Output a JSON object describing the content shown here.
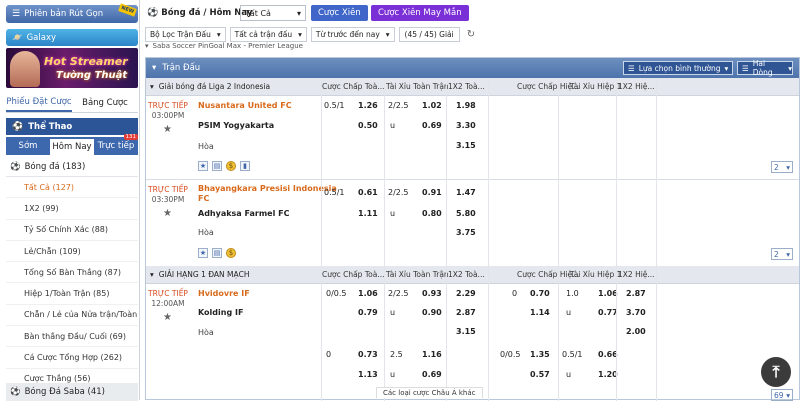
{
  "sidebar": {
    "rut_gon": "Phiên bản Rút Gọn",
    "new_tag": "NEW",
    "galaxy": "Galaxy",
    "banner_line1": "Hot Streamer",
    "banner_line2": "Tường Thuật",
    "tab_phieu": "Phiếu Đặt Cược",
    "tab_bang": "Bảng Cược",
    "sport_title": "Thể Thao",
    "tab_som": "Sớm",
    "tab_homnay": "Hôm Nay",
    "tab_tructiep": "Trực tiếp",
    "tructiep_badge": "131",
    "bongda": "Bóng đá  (183)",
    "items": [
      "Tất Cả  (127)",
      "1X2  (99)",
      "Tỷ Số Chính Xác  (88)",
      "Lẻ/Chẵn  (109)",
      "Tổng Số Bàn Thắng  (87)",
      "Hiệp 1/Toàn Trận  (85)",
      "Chẵn / Lẻ của Nửa trận/Toàn  (78)",
      "Bàn thắng Đầu/ Cuối  (69)",
      "Cá Cược Tổng Hợp  (262)",
      "Cược Thắng  (56)"
    ],
    "saba": "Bóng Đá Saba  (41)"
  },
  "topbar": {
    "title": "Bóng đá / Hôm Nay",
    "select": "Tất Cả",
    "btn_xien": "Cược Xiên",
    "btn_may": "Cược Xiên May Mắn"
  },
  "filters": {
    "f1": "Bộ Lọc Trận Đấu",
    "f2": "Tất cả trận đấu",
    "f3": "Từ trước đến nay",
    "count": "(45 / 45) Giải"
  },
  "league_top": "Saba Soccer PinGoal Max - Premier League",
  "panel": {
    "title": "Trận Đấu",
    "dd1": "Lựa chọn bình thường",
    "dd2": "Hai Dòng"
  },
  "headers": {
    "c1": "Cược Chấp Toà...",
    "c2": "Tài Xỉu Toàn Trận",
    "c3": "1X2 Toà...",
    "c4": "Cược Chấp Hiệ...",
    "c5": "Tài Xỉu Hiệp 1",
    "c6": "1X2 Hiệ..."
  },
  "leagues": {
    "l1": "Giải bóng đá Liga 2 Indonesia",
    "l2": "GIẢI HẠNG 1 ĐAN MẠCH"
  },
  "matches": {
    "m1": {
      "live": "TRỰC TIẾP",
      "time": "03:00PM",
      "home": "Nusantara United FC",
      "away": "PSIM Yogyakarta",
      "draw": "Hòa",
      "h1": "0.5/1",
      "h1o": "1.26",
      "t1": "2/2.5",
      "t1o": "1.02",
      "x1": "1.98",
      "h2o": "0.50",
      "t2": "u",
      "t2o": "0.69",
      "x2": "3.30",
      "x3": "3.15",
      "more": "2"
    },
    "m2": {
      "live": "TRỰC TIẾP",
      "time": "03:30PM",
      "home": "Bhayangkara Presisi Indonesia",
      "home2": "FC",
      "away": "Adhyaksa Farmel FC",
      "draw": "Hòa",
      "h1": "0.5/1",
      "h1o": "0.61",
      "t1": "2/2.5",
      "t1o": "0.91",
      "x1": "1.47",
      "h2o": "1.11",
      "t2": "u",
      "t2o": "0.80",
      "x2": "5.80",
      "x3": "3.75",
      "more": "2"
    },
    "m3": {
      "live": "TRỰC TIẾP",
      "time": "12:00AM",
      "home": "Hvidovre IF",
      "away": "Kolding IF",
      "draw": "Hòa",
      "h1": "0/0.5",
      "h1o": "1.06",
      "t1": "2/2.5",
      "t1o": "0.93",
      "x1": "2.29",
      "hh1": "0",
      "hh1o": "0.70",
      "th1": "1.0",
      "th1o": "1.06",
      "xh1": "2.87",
      "h2o": "0.79",
      "t2": "u",
      "t2o": "0.90",
      "x2": "2.87",
      "hh2o": "1.14",
      "th2": "u",
      "th2o": "0.77",
      "xh2": "3.70",
      "x3": "3.15",
      "xh3": "2.00",
      "r4a": "0",
      "r4b": "0.73",
      "r4c": "2.5",
      "r4d": "1.16",
      "r4e": "0/0.5",
      "r4f": "1.35",
      "r4g": "0.5/1",
      "r4h": "0.66",
      "r5b": "1.13",
      "r5c": "u",
      "r5d": "0.69",
      "r5f": "0.57",
      "r5g": "u",
      "r5h": "1.20",
      "more": "69"
    }
  },
  "bottom_text": "Các loại cược Châu Á khác"
}
